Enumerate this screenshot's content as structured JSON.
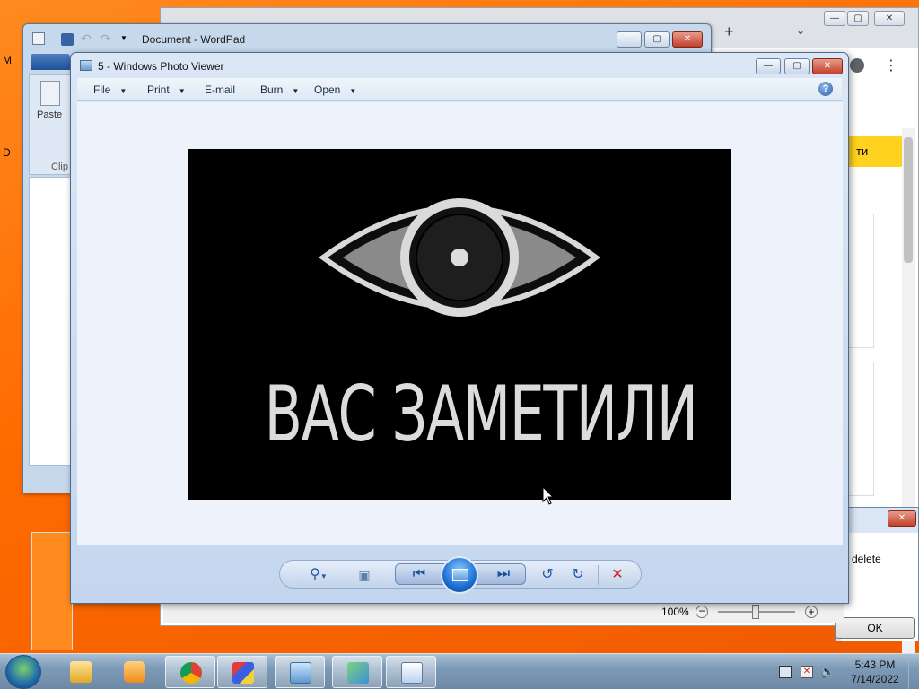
{
  "wordpad": {
    "title": "Document - WordPad",
    "paste_label": "Paste",
    "clipboard_label": "Clip"
  },
  "photo_viewer": {
    "title": "5 - Windows Photo Viewer",
    "menu": [
      {
        "label": "File",
        "has_dropdown": true
      },
      {
        "label": "Print",
        "has_dropdown": true
      },
      {
        "label": "E-mail",
        "has_dropdown": false
      },
      {
        "label": "Burn",
        "has_dropdown": true
      },
      {
        "label": "Open",
        "has_dropdown": true
      }
    ],
    "help_label": "?",
    "image_caption": "ВАС ЗАМЕТИЛИ",
    "toolbar_icons": [
      "zoom-icon",
      "actual-size-icon",
      "previous-icon",
      "slideshow-icon",
      "next-icon",
      "rotate-left-icon",
      "rotate-right-icon",
      "delete-icon"
    ]
  },
  "background_browser": {
    "partial_button_text": "ти",
    "zoom_level": "100%"
  },
  "dialog": {
    "partial_text": "delete",
    "ok_label": "OK"
  },
  "taskbar": {
    "time": "5:43 PM",
    "date": "7/14/2022"
  },
  "colors": {
    "desktop": "#ff6a00",
    "accent_yellow": "#ffd21f",
    "close_red": "#c2412b"
  }
}
